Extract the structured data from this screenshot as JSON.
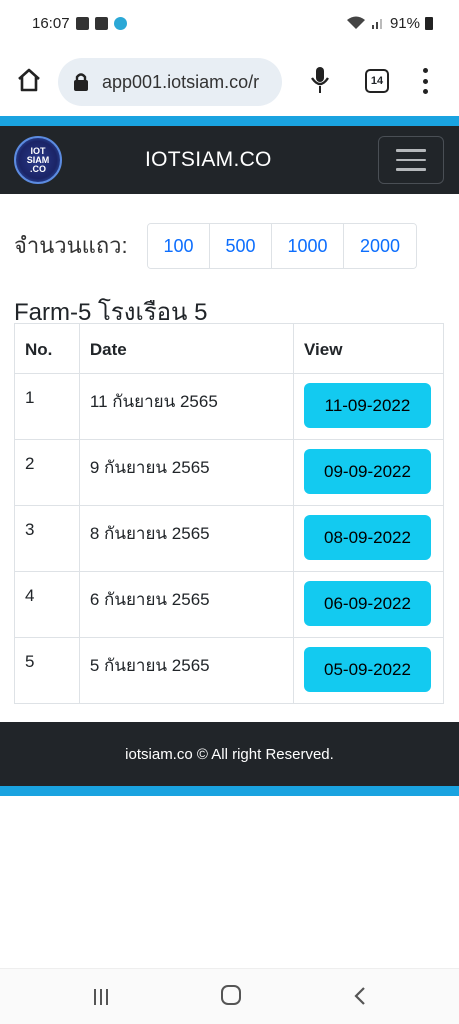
{
  "status_bar": {
    "time": "16:07",
    "battery": "91%",
    "icons": [
      "image-icon",
      "youtube-icon",
      "app-icon",
      "wifi-icon",
      "signal-icon",
      "battery-icon"
    ]
  },
  "browser": {
    "url": "app001.iotsiam.co/r",
    "tab_count": "14"
  },
  "navbar": {
    "brand": "IOTSIAM.CO",
    "logo_text": [
      "IOT",
      "SIAM",
      ".CO"
    ]
  },
  "rows_selector": {
    "label": "จำนวนแถว:",
    "options": [
      "100",
      "500",
      "1000",
      "2000"
    ]
  },
  "farm_title": "Farm-5 โรงเรือน 5",
  "table": {
    "headers": [
      "No.",
      "Date",
      "View"
    ],
    "rows": [
      {
        "no": "1",
        "date": "11 กันยายน 2565",
        "view": "11-09-2022"
      },
      {
        "no": "2",
        "date": "9 กันยายน 2565",
        "view": "09-09-2022"
      },
      {
        "no": "3",
        "date": "8 กันยายน 2565",
        "view": "08-09-2022"
      },
      {
        "no": "4",
        "date": "6 กันยายน 2565",
        "view": "06-09-2022"
      },
      {
        "no": "5",
        "date": "5 กันยายน 2565",
        "view": "05-09-2022"
      }
    ]
  },
  "footer": {
    "text": "iotsiam.co © All right Reserved."
  },
  "colors": {
    "accent": "#1aa3e0",
    "navbar_bg": "#212529",
    "view_button": "#13caf0",
    "link": "#0d6efd"
  }
}
